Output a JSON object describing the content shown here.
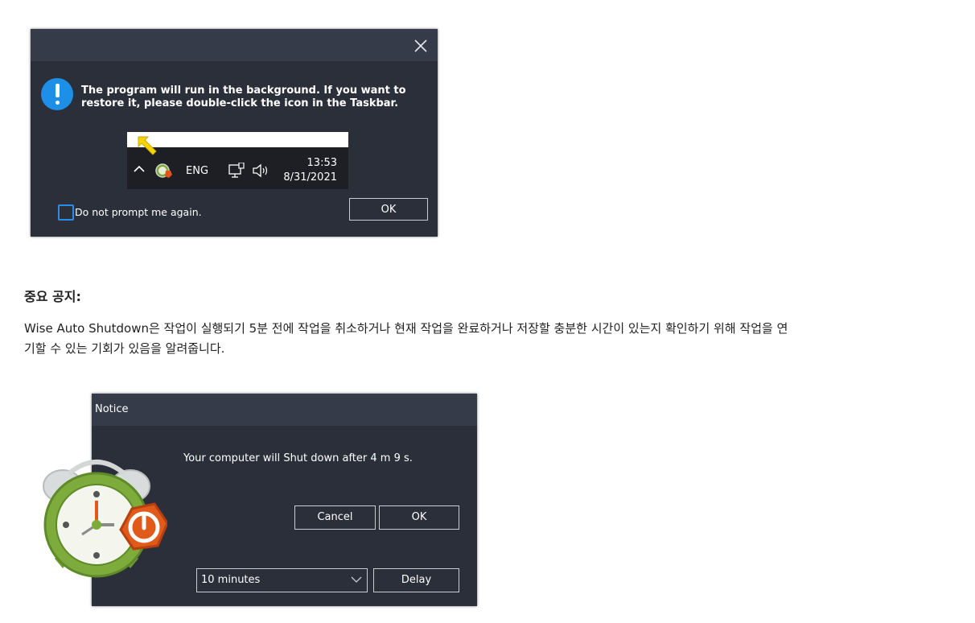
{
  "dialog1": {
    "close_icon": "close-icon",
    "message_line1": "The program will run in the background. If you want to",
    "message_line2": "restore it, please double-click the icon in the Taskbar.",
    "taskbar": {
      "lang": "ENG",
      "time": "13:53",
      "date": "8/31/2021"
    },
    "checkbox_label": "Do not prompt me again.",
    "ok_label": "OK"
  },
  "section": {
    "heading": "중요 공지:",
    "paragraph_line1": "Wise Auto Shutdown은 작업이 실행되기 5분 전에 작업을 취소하거나 현재 작업을 완료하거나 저장할 충분한 시간이 있는지 확인하기 위해 작업을 연",
    "paragraph_line2": "기할 수 있는 기회가 있음을 알려줍니다."
  },
  "dialog2": {
    "title": "Notice",
    "message": "Your computer will Shut down after 4 m 9 s.",
    "cancel_label": "Cancel",
    "ok_label": "OK",
    "delay_select_value": "10 minutes",
    "delay_label": "Delay"
  },
  "colors": {
    "dialog_bg": "#2b2f3a",
    "titlebar_bg": "#353b48",
    "info_blue": "#1e8fe6",
    "checkbox_blue": "#2e8be6"
  }
}
